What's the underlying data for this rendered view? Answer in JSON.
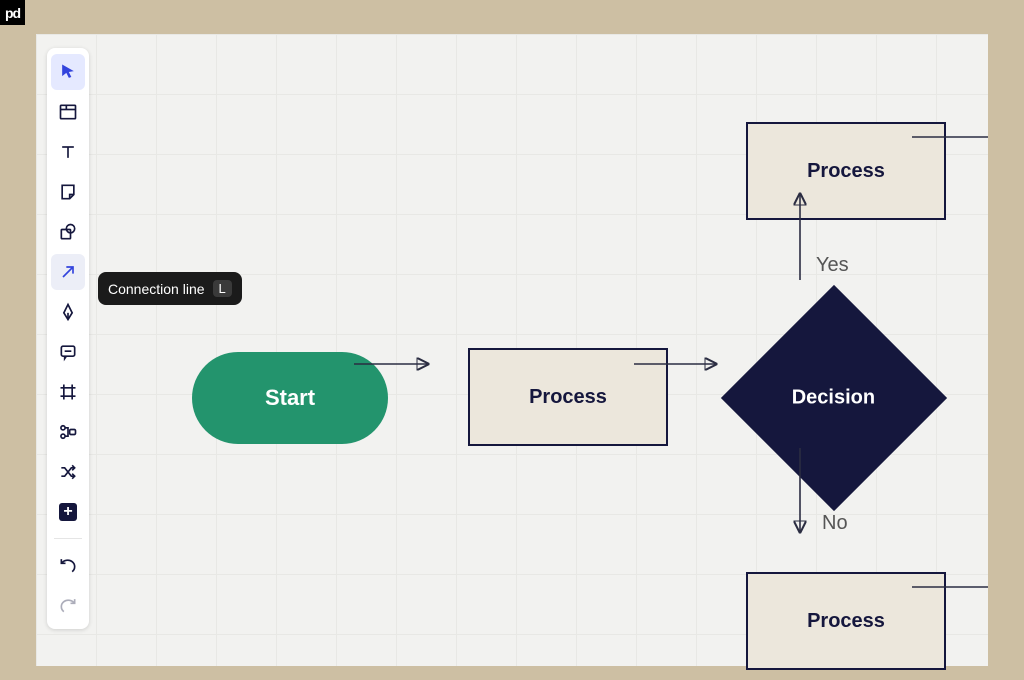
{
  "brand": {
    "label": "pd"
  },
  "toolbar": {
    "items": [
      {
        "name": "select",
        "icon": "cursor",
        "selected": true
      },
      {
        "name": "container",
        "icon": "layout",
        "selected": false
      },
      {
        "name": "text",
        "icon": "text",
        "selected": false
      },
      {
        "name": "note",
        "icon": "sticky-note",
        "selected": false
      },
      {
        "name": "shape",
        "icon": "shape-union",
        "selected": false
      },
      {
        "name": "connection",
        "icon": "arrow-upright",
        "selected": false,
        "tooltip_active": true
      },
      {
        "name": "pen",
        "icon": "pen-fountain",
        "selected": false
      },
      {
        "name": "comment",
        "icon": "comment",
        "selected": false
      },
      {
        "name": "frame",
        "icon": "crop-frame",
        "selected": false
      },
      {
        "name": "nodes",
        "icon": "nodes",
        "selected": false
      },
      {
        "name": "shuffle",
        "icon": "shuffle",
        "selected": false
      },
      {
        "name": "add",
        "icon": "plus-square",
        "selected": false
      }
    ],
    "undo_redo": {
      "undo": "undo",
      "redo": "redo"
    }
  },
  "tooltip": {
    "label": "Connection line",
    "shortcut": "L"
  },
  "flow": {
    "start": {
      "label": "Start"
    },
    "process_mid": {
      "label": "Process"
    },
    "process_top": {
      "label": "Process"
    },
    "process_bot": {
      "label": "Process"
    },
    "decision": {
      "label": "Decision"
    },
    "edge_yes": "Yes",
    "edge_no": "No"
  }
}
